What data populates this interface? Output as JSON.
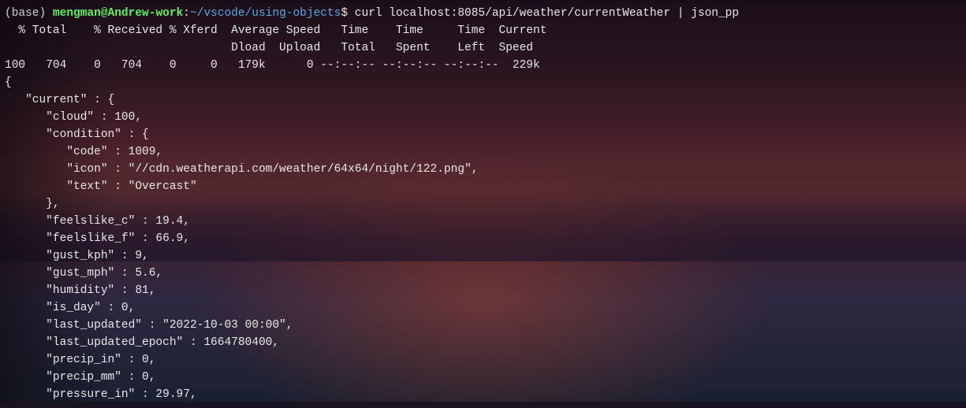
{
  "prompt": {
    "env_open": "(",
    "env_name": "base",
    "env_close": ") ",
    "user_host": "mengman@Andrew-work",
    "colon": ":",
    "cwd": "~/vscode/using-objects",
    "sigil": "$ ",
    "command": "curl localhost:8085/api/weather/currentWeather | json_pp"
  },
  "curl_header_line1": "  % Total    % Received % Xferd  Average Speed   Time    Time     Time  Current",
  "curl_header_line2": "                                 Dload  Upload   Total   Spent    Left  Speed",
  "curl_progress": "100   704    0   704    0     0   179k      0 --:--:-- --:--:-- --:--:--  229k",
  "json_lines": [
    "{",
    "   \"current\" : {",
    "      \"cloud\" : 100,",
    "      \"condition\" : {",
    "         \"code\" : 1009,",
    "         \"icon\" : \"//cdn.weatherapi.com/weather/64x64/night/122.png\",",
    "         \"text\" : \"Overcast\"",
    "      },",
    "      \"feelslike_c\" : 19.4,",
    "      \"feelslike_f\" : 66.9,",
    "      \"gust_kph\" : 9,",
    "      \"gust_mph\" : 5.6,",
    "      \"humidity\" : 81,",
    "      \"is_day\" : 0,",
    "      \"last_updated\" : \"2022-10-03 00:00\",",
    "      \"last_updated_epoch\" : 1664780400,",
    "      \"precip_in\" : 0,",
    "      \"precip_mm\" : 0,",
    "      \"pressure_in\" : 29.97,"
  ],
  "curl_stats": {
    "total_pct": 100,
    "total_bytes": 704,
    "received_pct": 0,
    "received_bytes": 704,
    "xferd_pct": 0,
    "xferd_bytes": 0,
    "dload_speed": "179k",
    "upload_speed": 0,
    "time_total": "--:--:--",
    "time_spent": "--:--:--",
    "time_left": "--:--:--",
    "current_speed": "229k"
  },
  "weather_data": {
    "current": {
      "cloud": 100,
      "condition": {
        "code": 1009,
        "icon": "//cdn.weatherapi.com/weather/64x64/night/122.png",
        "text": "Overcast"
      },
      "feelslike_c": 19.4,
      "feelslike_f": 66.9,
      "gust_kph": 9,
      "gust_mph": 5.6,
      "humidity": 81,
      "is_day": 0,
      "last_updated": "2022-10-03 00:00",
      "last_updated_epoch": 1664780400,
      "precip_in": 0,
      "precip_mm": 0,
      "pressure_in": 29.97
    }
  }
}
